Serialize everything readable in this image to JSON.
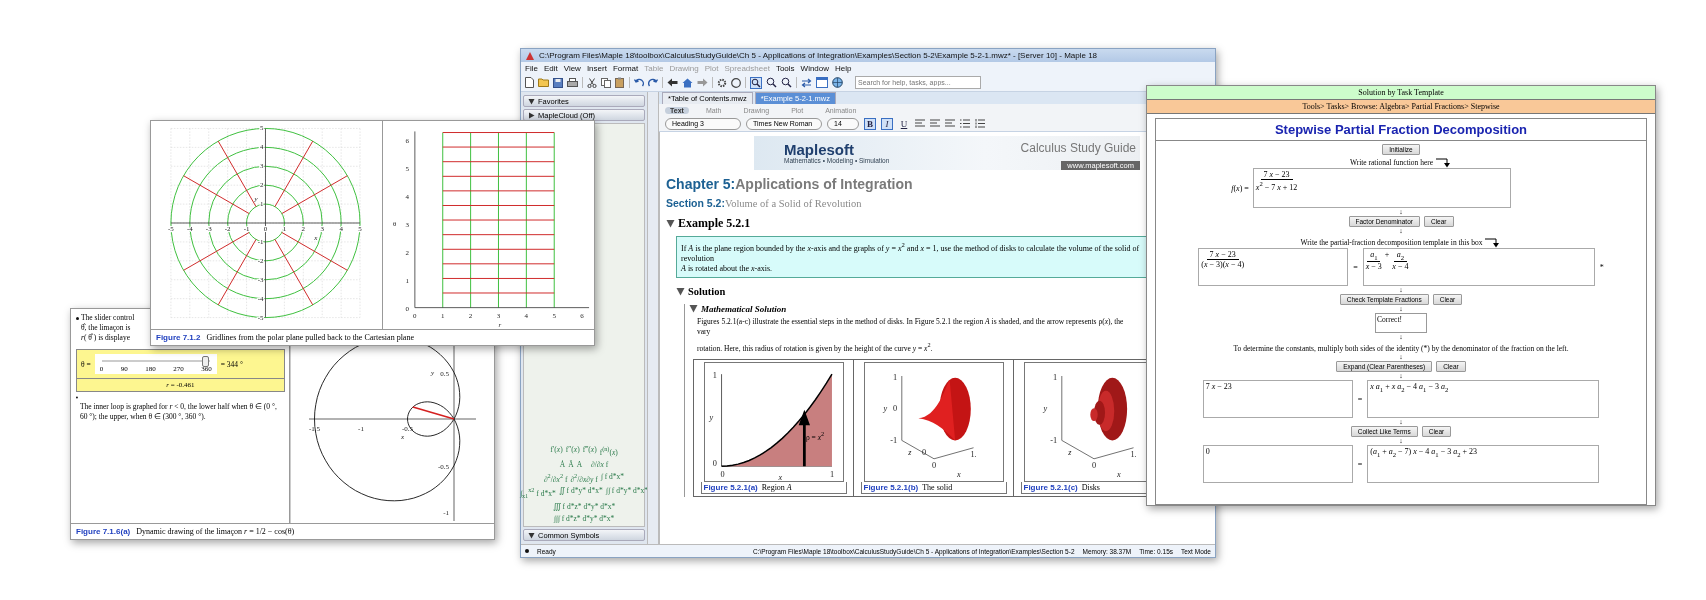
{
  "maple_window": {
    "title": "C:\\Program Files\\Maple 18\\toolbox\\CalculusStudyGuide\\Ch 5 - Applications of Integration\\Examples\\Section 5-2\\Example 5-2-1.mwz* - [Server 10] - Maple 18",
    "menu": [
      {
        "label": "File",
        "disabled": false
      },
      {
        "label": "Edit",
        "disabled": false
      },
      {
        "label": "View",
        "disabled": false
      },
      {
        "label": "Insert",
        "disabled": false
      },
      {
        "label": "Format",
        "disabled": false
      },
      {
        "label": "Table",
        "disabled": true
      },
      {
        "label": "Drawing",
        "disabled": true
      },
      {
        "label": "Plot",
        "disabled": true
      },
      {
        "label": "Spreadsheet",
        "disabled": true
      },
      {
        "label": "Tools",
        "disabled": false
      },
      {
        "label": "Window",
        "disabled": false
      },
      {
        "label": "Help",
        "disabled": false
      }
    ],
    "search": {
      "placeholder": "Search for help, tasks, apps..."
    },
    "palettes": [
      {
        "label": "Favorites",
        "expanded": true
      },
      {
        "label": "MapleCloud (Off)",
        "expanded": false
      },
      {
        "label": "Common Symbols",
        "expanded": true
      }
    ],
    "palette_expressions": [
      [
        "f′(*x*)",
        "f″(*x*)",
        "f‴(*x*)",
        "f$^{(n)}$(*x*)"
      ],
      [
        "Ȧ",
        "Ä",
        "A⃛",
        "∂/∂*x* f"
      ],
      [
        "∂$^{2}$/∂*x*$^{2}$ f",
        "∂$^{2}$/∂*x*∂*y* f",
        "∫ f d*x*"
      ],
      [
        "∫$_{x1}$$^{x2}$ f d*x*",
        "∬ f d*y* d*x*",
        "∫∫ f d*y* d*x*"
      ],
      [
        "∭ f d*z* d*y* d*x*"
      ],
      [
        "∫∫∫ f d*z* d*y* d*x*"
      ]
    ],
    "tabs": [
      {
        "label": "*Table of Contents.mwz",
        "selected": false
      },
      {
        "label": "*Example 5-2-1.mwz",
        "selected": true
      }
    ],
    "mode_tabs": [
      {
        "label": "Text",
        "selected": true
      },
      {
        "label": "Math",
        "selected": false
      },
      {
        "label": "Drawing",
        "selected": false
      },
      {
        "label": "Plot",
        "selected": false
      },
      {
        "label": "Animation",
        "selected": false
      }
    ],
    "format": {
      "paragraph_style": "Heading 3",
      "font": "Times New Roman",
      "size": "14",
      "toggles": [
        {
          "label": "B",
          "on": true
        },
        {
          "label": "I",
          "on": true
        },
        {
          "label": "U",
          "on": false
        }
      ]
    },
    "banner": {
      "logo": "Maplesoft",
      "tagline": "Mathematics • Modeling • Simulation",
      "title": "Calculus Study Guide",
      "url": "www.maplesoft.com"
    },
    "chapter": {
      "number": "Chapter 5:",
      "title": "Applications of Integration"
    },
    "section": {
      "number": "Section 5.2:",
      "title": "Volume of a Solid of Revolution"
    },
    "example": {
      "title": "Example 5.2.1",
      "expanded": true,
      "statement": [
        "If *A* is the plane region bounded by the *x*-axis and the graphs of *y* = *x*$^{2}$ and *x* = 1, use the method of disks to calculate the volume of the solid of revolution",
        "*A* is rotated about the *x*-axis."
      ]
    },
    "solution": {
      "title": "Solution",
      "expanded": true
    },
    "method": {
      "title": "Mathematical Solution",
      "expanded": true,
      "paragraphs": [
        "Figures 5.2.1(a-c) illustrate the essential steps in the method of disks. In Figure 5.2.1 the region *A* is shaded, and the arrow represents ρ(*x*), the vary",
        "rotation. Here, this radius of rotation is given by the height of the curve *y* = *x*$^{2}$."
      ]
    },
    "figures": [
      {
        "kind": "region",
        "label": "Figure 5.2.1(a)",
        "caption": "Region *A*",
        "x_ticks": [
          "0",
          "1"
        ],
        "y_ticks": [
          "1",
          "0"
        ],
        "x_label": "x",
        "y_label": "y",
        "annotation": "ρ = *x*$^{2}$"
      },
      {
        "kind": "solid",
        "label": "Figure 5.2.1(b)",
        "caption": "The solid",
        "x_ticks": [
          "0",
          "1."
        ],
        "y_ticks": [
          "1",
          "0",
          "-1"
        ],
        "z_ticks": [
          "0"
        ],
        "x_label": "x",
        "y_label": "y",
        "z_label": "z"
      },
      {
        "kind": "disks",
        "label": "Figure 5.2.1(c)",
        "caption": "Disks",
        "x_ticks": [
          "0",
          "1."
        ],
        "y_ticks": [
          "1",
          "-1"
        ],
        "x_label": "x",
        "y_label": "y",
        "z_label": "z"
      }
    ],
    "status_bar": {
      "state": "Ready",
      "path": "C:\\Program Files\\Maple 18\\toolbox\\CalculusStudyGuide\\Ch 5 - Applications of Integration\\Examples\\Section 5-2",
      "memory": "Memory: 38.37M",
      "time": "Time: 0.15s",
      "mode": "Text Mode"
    }
  },
  "limacon_window": {
    "bullet_lines": [
      "The slider control",
      "θ̂, the limaçon is",
      "*r*( θ̂ ) is displaye"
    ],
    "slider": {
      "label": "θ =",
      "ticks": [
        "0",
        "90",
        "180",
        "270",
        "360"
      ],
      "level": 0.955,
      "reading": "= 344 °",
      "result": "*r* = -0.461"
    },
    "bullet_2": "The inner loop is graphed for *r* < 0, the lower half when θ ∈ (0 °, 60 °); the upper, when θ ∈ (300 °, 360 °).",
    "plot": {
      "x_ticks": [
        "-1.5",
        "-1",
        "-0.5"
      ],
      "y_ticks": [
        "0.5",
        "-0.5",
        "-1"
      ],
      "x_label": "x",
      "y_label": "y"
    },
    "caption": {
      "label": "Figure 7.1.6(a)",
      "text": "Dynamic drawing of the limaçon *r* = 1/2 − cos(θ)"
    }
  },
  "polar_figure_window": {
    "polar_plot": {
      "x_ticks": [
        "-5",
        "-4",
        "-3",
        "-2",
        "-1",
        "0",
        "1",
        "2",
        "3",
        "4",
        "5"
      ],
      "y_ticks": [
        "5",
        "4",
        "3",
        "2",
        "1",
        "-1",
        "-2",
        "-3",
        "-4",
        "-5"
      ],
      "x_label": "x",
      "y_label": "y"
    },
    "grid_plot": {
      "x_ticks": [
        "0",
        "1",
        "2",
        "3",
        "4",
        "5",
        "6"
      ],
      "y_ticks": [
        "6",
        "5",
        "4",
        "3",
        "2",
        "1",
        "0"
      ],
      "x_label": "r",
      "y_label": "θ"
    },
    "caption": {
      "label": "Figure 7.1.2",
      "text": "Gridlines from the polar plane pulled back to the Cartesian plane"
    }
  },
  "task_template_window": {
    "header": "Solution by Task Template",
    "path": "Tools> Tasks> Browse: Algebra> Partial Fractions> Stepwise",
    "title": "Stepwise Partial Fraction Decomposition",
    "steps": [
      {
        "kind": "buttons",
        "buttons": [
          "Initialize"
        ]
      },
      {
        "kind": "prompt",
        "text": "Write rational function here",
        "bent_arrow": true
      },
      {
        "kind": "function",
        "label": "*f*(*x*) =",
        "terms": [
          {
            "kind": "frac",
            "num": "7 *x* − 23",
            "den": "*x*$^{2}$ − 7 *x* + 12"
          }
        ]
      },
      {
        "kind": "arrow",
        "glyph": "↓"
      },
      {
        "kind": "buttons",
        "buttons": [
          "Factor Denominator",
          "Clear"
        ]
      },
      {
        "kind": "arrow",
        "glyph": "↓"
      },
      {
        "kind": "prompt",
        "text": "Write the partial-fraction decomposition template in this box",
        "bent_arrow": true
      },
      {
        "kind": "equation",
        "relation": "=",
        "mark": "*",
        "left": [
          {
            "kind": "frac",
            "num": "7 *x* − 23",
            "den": "(*x* − 3)(*x* − 4)"
          }
        ],
        "right": [
          {
            "kind": "frac",
            "num": "*a*$_{1}$",
            "den": "*x* − 3"
          },
          {
            "kind": "text",
            "text": "+"
          },
          {
            "kind": "frac",
            "num": "*a*$_{2}$",
            "den": "*x* − 4"
          }
        ]
      },
      {
        "kind": "arrow",
        "glyph": "↓"
      },
      {
        "kind": "buttons",
        "buttons": [
          "Check Template Fractions",
          "Clear"
        ]
      },
      {
        "kind": "arrow",
        "glyph": "↓"
      },
      {
        "kind": "output",
        "text": "Correct!"
      },
      {
        "kind": "arrow",
        "glyph": "↓"
      },
      {
        "kind": "prompt",
        "text": "To determine the constants, multiply both sides of the identity (*) by the denominator of the fraction on the left.",
        "bent_arrow": false
      },
      {
        "kind": "arrow",
        "glyph": "↓"
      },
      {
        "kind": "buttons",
        "buttons": [
          "Expand (Clear Parentheses)",
          "Clear"
        ]
      },
      {
        "kind": "arrow",
        "glyph": "↓"
      },
      {
        "kind": "equation",
        "relation": "=",
        "left": [
          {
            "kind": "text",
            "text": "7 *x* − 23"
          }
        ],
        "right": [
          {
            "kind": "text",
            "text": "*x a*$_{1}$ + *x a*$_{2}$ − 4 *a*$_{1}$ − 3 *a*$_{2}$"
          }
        ]
      },
      {
        "kind": "arrow",
        "glyph": "↓"
      },
      {
        "kind": "buttons",
        "buttons": [
          "Collect Like Terms",
          "Clear"
        ]
      },
      {
        "kind": "arrow",
        "glyph": "↓"
      },
      {
        "kind": "equation",
        "relation": "=",
        "left": [
          {
            "kind": "text",
            "text": "0"
          }
        ],
        "right": [
          {
            "kind": "text",
            "text": "(*a*$_{1}$ + *a*$_{2}$ − 7) *x* − 4 *a*$_{1}$ − 3 *a*$_{2}$ + 23"
          }
        ]
      }
    ]
  }
}
